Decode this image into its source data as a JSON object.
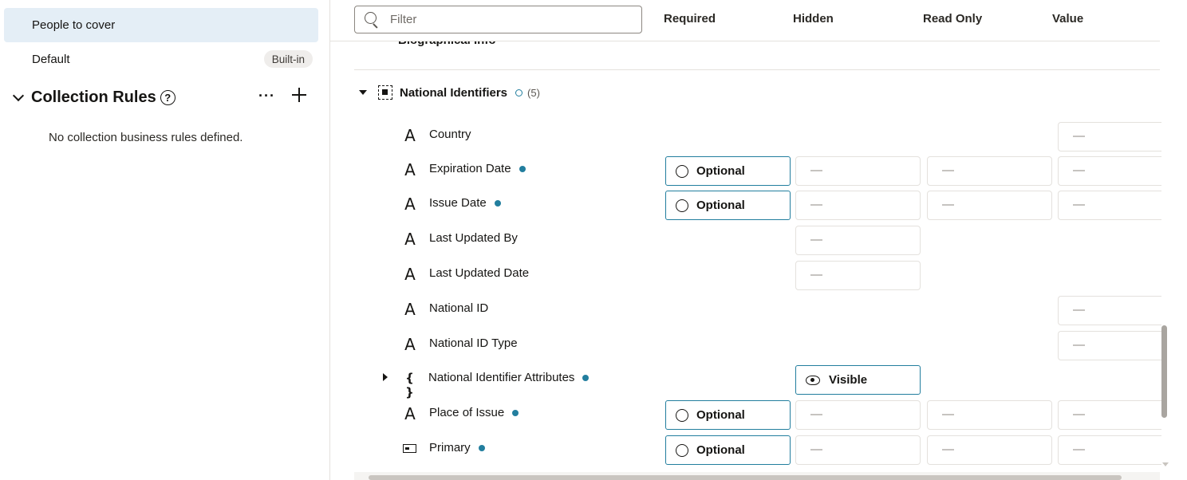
{
  "left_panel": {
    "items": [
      {
        "label": "People to cover",
        "selected": true
      },
      {
        "label": "Default",
        "badge": "Built-in"
      }
    ],
    "collection_rules": {
      "title": "Collection Rules",
      "help_icon": "help-circle-icon",
      "more_icon": "ellipsis-icon",
      "add_icon": "plus-icon",
      "empty_message": "No collection business rules defined."
    }
  },
  "toolbar": {
    "filter_placeholder": "Filter",
    "filter_value": ""
  },
  "columns": [
    "Required",
    "Hidden",
    "Read Only",
    "Value"
  ],
  "cut_off_group": {
    "title": "Biographical Info"
  },
  "group": {
    "title": "National Identifiers",
    "count": "(5)"
  },
  "rows": [
    {
      "label": "Country",
      "icon": "text-attribute-icon"
    },
    {
      "label": "Expiration Date",
      "icon": "text-attribute-icon",
      "required_label": "Optional"
    },
    {
      "label": "Issue Date",
      "icon": "text-attribute-icon",
      "required_label": "Optional"
    },
    {
      "label": "Last Updated By",
      "icon": "text-attribute-icon"
    },
    {
      "label": "Last Updated Date",
      "icon": "text-attribute-icon"
    },
    {
      "label": "National ID",
      "icon": "text-attribute-icon"
    },
    {
      "label": "National ID Type",
      "icon": "text-attribute-icon"
    },
    {
      "label": "National Identifier Attributes",
      "icon": "braces-icon",
      "hidden_label": "Visible"
    },
    {
      "label": "Place of Issue",
      "icon": "text-attribute-icon",
      "required_label": "Optional"
    },
    {
      "label": "Primary",
      "icon": "boolean-field-icon",
      "required_label": "Optional"
    }
  ],
  "colors": {
    "accent": "#227e9e",
    "selected_bg": "#e4eef6"
  }
}
